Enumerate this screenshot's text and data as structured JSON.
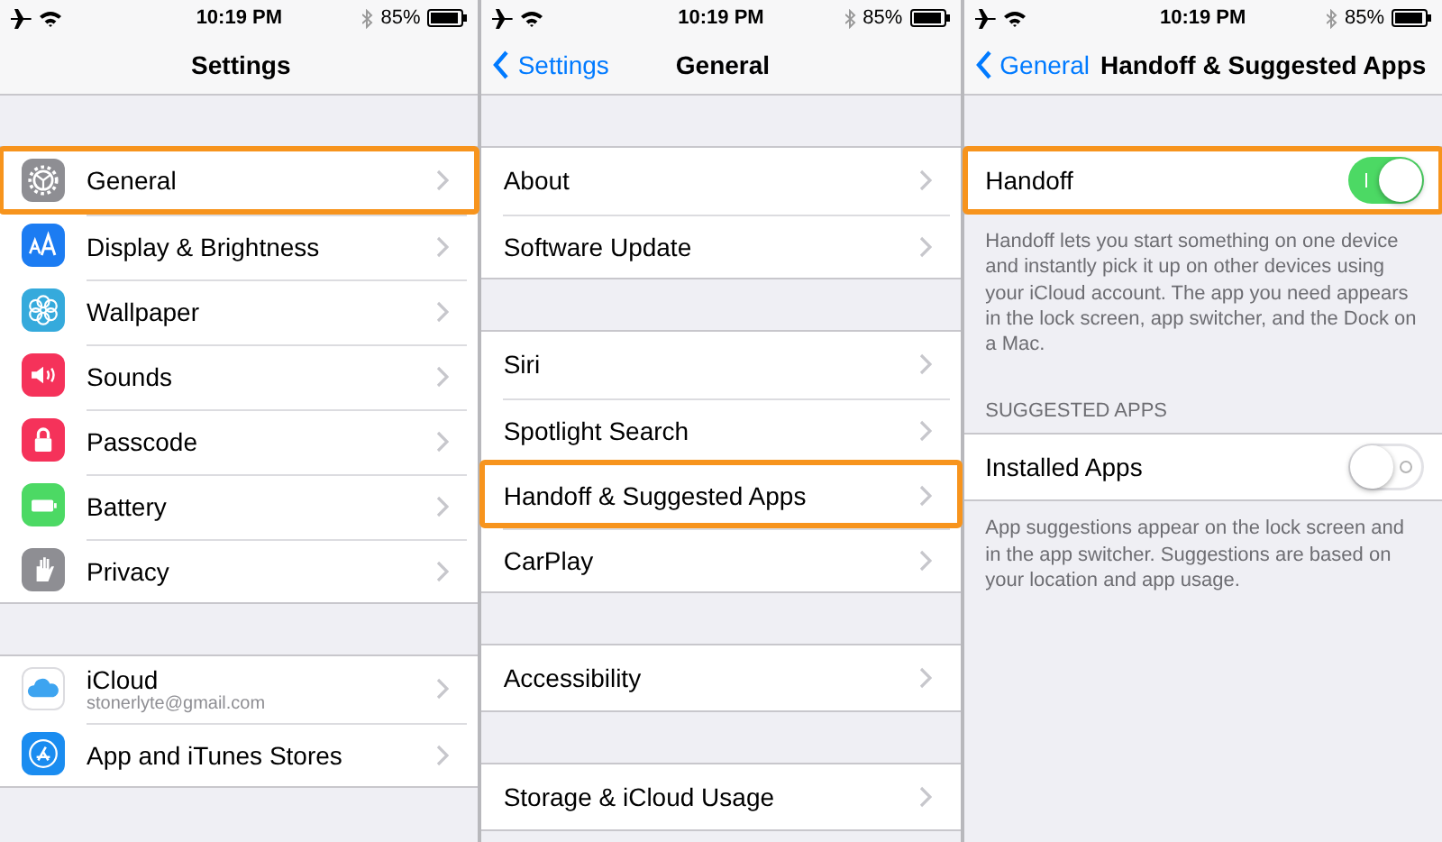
{
  "panels": [
    {
      "status_bar": {
        "time": "10:19 PM",
        "battery": "85%"
      },
      "nav": {
        "title": "Settings"
      },
      "sections": [
        {
          "rows": [
            {
              "label": "General",
              "color": "#8e8e93",
              "highlighted": true
            },
            {
              "label": "Display & Brightness",
              "color": "#1c7cf2",
              "highlighted": false
            },
            {
              "label": "Wallpaper",
              "color": "#35aadc",
              "highlighted": false
            },
            {
              "label": "Sounds",
              "color": "#f5325a",
              "highlighted": false
            },
            {
              "label": "Passcode",
              "color": "#f5325a",
              "highlighted": false
            },
            {
              "label": "Battery",
              "color": "#4cd964",
              "highlighted": false
            },
            {
              "label": "Privacy",
              "color": "#8e8e93",
              "highlighted": false
            }
          ]
        },
        {
          "rows": [
            {
              "label": "iCloud",
              "subtitle": "stonerlyte@gmail.com",
              "color": "#ffffff",
              "highlighted": false
            },
            {
              "label": "App and iTunes Stores",
              "color": "#1a8cf0",
              "highlighted": false
            }
          ]
        }
      ]
    },
    {
      "status_bar": {
        "time": "10:19 PM",
        "battery": "85%"
      },
      "nav": {
        "back": "Settings",
        "title": "General"
      },
      "sections": [
        {
          "rows": [
            {
              "label": "About",
              "highlighted": false
            },
            {
              "label": "Software Update",
              "highlighted": false
            }
          ]
        },
        {
          "rows": [
            {
              "label": "Siri",
              "highlighted": false
            },
            {
              "label": "Spotlight Search",
              "highlighted": false
            },
            {
              "label": "Handoff & Suggested Apps",
              "highlighted": true
            },
            {
              "label": "CarPlay",
              "highlighted": false
            }
          ]
        },
        {
          "rows": [
            {
              "label": "Accessibility",
              "highlighted": false
            }
          ]
        },
        {
          "rows": [
            {
              "label": "Storage & iCloud Usage",
              "highlighted": false
            }
          ]
        }
      ]
    },
    {
      "status_bar": {
        "time": "10:19 PM",
        "battery": "85%"
      },
      "nav": {
        "back": "General",
        "title": "Handoff & Suggested Apps"
      },
      "sections": [
        {
          "rows": [
            {
              "kind": "toggle",
              "label": "Handoff",
              "on": true,
              "highlighted": true
            }
          ],
          "footer": "Handoff lets you start something on one device and instantly pick it up on other devices using your iCloud account. The app you need appears in the lock screen, app switcher, and the Dock on a Mac."
        },
        {
          "header": "SUGGESTED APPS",
          "rows": [
            {
              "kind": "toggle",
              "label": "Installed Apps",
              "on": false,
              "highlighted": false
            }
          ],
          "footer": "App suggestions appear on the lock screen and in the app switcher. Suggestions are based on your location and app usage."
        }
      ]
    }
  ]
}
